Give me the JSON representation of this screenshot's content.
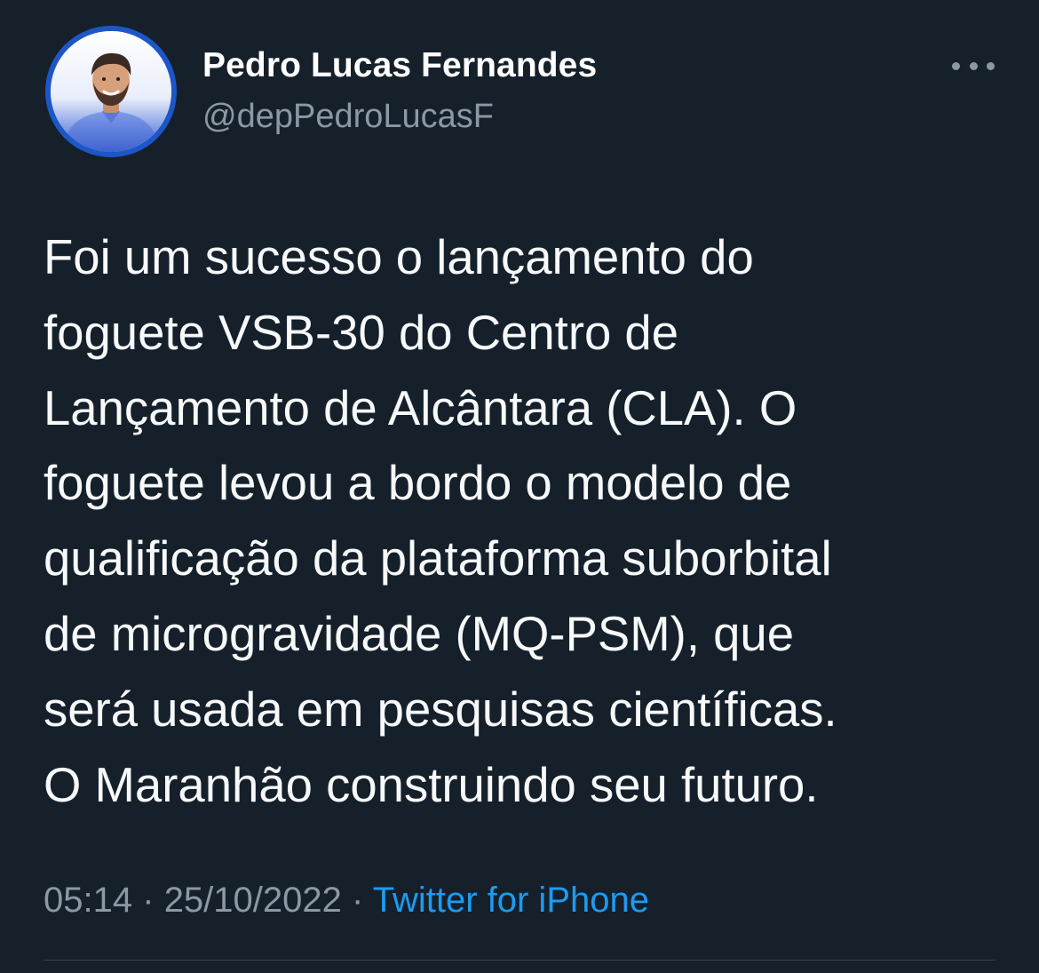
{
  "author": {
    "display_name": "Pedro Lucas Fernandes",
    "handle": "@depPedroLucasF",
    "avatar": "profile-photo"
  },
  "more_icon": "more-dots-icon",
  "tweet": {
    "lines": [
      "Foi um sucesso o lançamento do",
      "foguete VSB-30 do Centro de",
      "Lançamento de Alcântara (CLA). O",
      "foguete levou a bordo o modelo de",
      "qualificação da plataforma suborbital",
      "de microgravidade (MQ-PSM), que",
      "será usada em pesquisas científicas.",
      "O Maranhão construindo seu futuro."
    ]
  },
  "meta": {
    "time": "05:14",
    "separator": "·",
    "date": "25/10/2022",
    "source": "Twitter for iPhone"
  },
  "colors": {
    "background": "#15202b",
    "text_primary": "#f7f9f9",
    "text_secondary": "#8b98a5",
    "link": "#1d9bf0"
  }
}
